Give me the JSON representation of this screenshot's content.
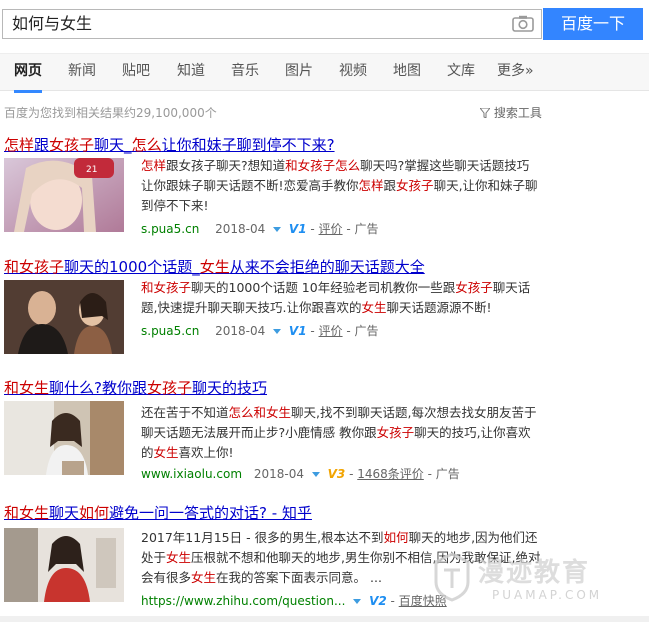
{
  "search": {
    "query": "如何与女生",
    "button_label": "百度一下"
  },
  "tabs": [
    "网页",
    "新闻",
    "贴吧",
    "知道",
    "音乐",
    "图片",
    "视频",
    "地图",
    "文库",
    "更多»"
  ],
  "stats": {
    "text": "百度为您找到相关结果约29,100,000个",
    "tools_label": "搜索工具"
  },
  "results": [
    {
      "title": [
        "",
        "怎样",
        "跟",
        "女孩子",
        "聊天_",
        "怎么",
        "让你和妹子聊到停不下来?"
      ],
      "desc": [
        "",
        "怎样",
        "跟女孩子聊天?想知道",
        "和女孩子怎么",
        "聊天吗?掌握这些聊天话题技巧让你跟妹子聊天话题不断!恋爱高手教你",
        "怎样",
        "跟",
        "女孩子",
        "聊天,让你和妹子聊到停不下来!"
      ],
      "url": "s.pua5.cn",
      "date": "2018-04",
      "v": "V1",
      "review": "评价",
      "ad": "广告"
    },
    {
      "title": [
        "",
        "和女孩子",
        "聊天的1000个话题_",
        "女生",
        "从来不会拒绝的聊天话题大全"
      ],
      "desc": [
        "",
        "和女孩子",
        "聊天的1000个话题 10年经验老司机教你一些跟",
        "女孩子",
        "聊天话题,快速提升聊天聊天技巧.让你跟喜欢的",
        "女生",
        "聊天话题源源不断!"
      ],
      "url": "s.pua5.cn",
      "date": "2018-04",
      "v": "V1",
      "review": "评价",
      "ad": "广告"
    },
    {
      "title": [
        "",
        "和女生",
        "聊什么?教你跟",
        "女孩子",
        "聊天的技巧"
      ],
      "desc": [
        "还在苦于不知道",
        "怎么和女生",
        "聊天,找不到聊天话题,每次想去找女朋友苦于聊天话题无法展开而止步?小鹿情感 教你跟",
        "女孩子",
        "聊天的技巧,让你喜欢的",
        "女生",
        "喜欢上你!"
      ],
      "url": "www.ixiaolu.com",
      "date": "2018-04",
      "v": "V3",
      "review": "1468条评价",
      "ad": "广告"
    },
    {
      "title": [
        "",
        "和女生",
        "聊天",
        "如何",
        "避免一问一答式的对话? - 知乎"
      ],
      "desc": [
        "2017年11月15日 - 很多的男生,根本达不到",
        "如何",
        "聊天的地步,因为他们还处于",
        "女生",
        "压根就不想和他聊天的地步,男生你别不相信,因为我敢保证,绝对会有很多",
        "女生",
        "在我的答案下面表示同意。 ..."
      ],
      "url": "https://www.zhihu.com/question...",
      "v": "V2",
      "cache": "百度快照"
    }
  ],
  "watermark": {
    "main": "漫迹教育",
    "sub": "PUAMAP.COM"
  },
  "colors": {
    "brand_blue": "#3385ff",
    "link": "#0000cc",
    "highlight": "#cc0000",
    "url_green": "#008000"
  }
}
